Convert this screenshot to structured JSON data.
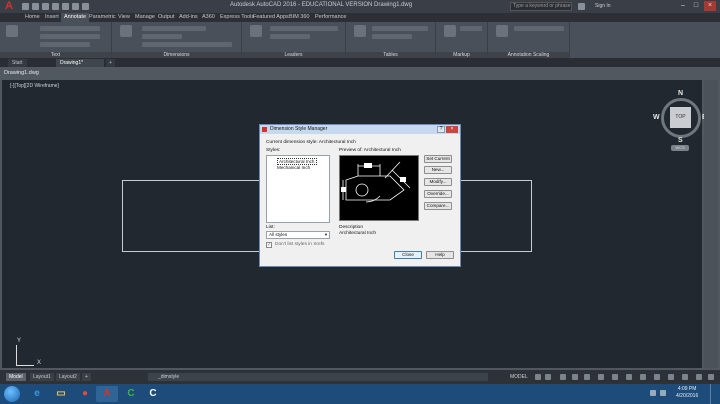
{
  "app": {
    "title": "Autodesk AutoCAD 2016 - EDUCATIONAL VERSION   Drawing1.dwg",
    "search_placeholder": "Type a keyword or phrase",
    "signin": "Sign In"
  },
  "ribbon_tabs": [
    "Home",
    "Insert",
    "Annotate",
    "Parametric",
    "View",
    "Manage",
    "Output",
    "Add-ins",
    "A360",
    "Express Tools",
    "Featured Apps",
    "BIM 360",
    "Performance"
  ],
  "ribbon_active_tab": "Annotate",
  "ribbon_panels": [
    "Text",
    "Dimensions",
    "Leaders",
    "Tables",
    "Markup",
    "Annotation Scaling"
  ],
  "doc_tabs": [
    "Start",
    "Drawing1*"
  ],
  "drawing": {
    "window_title": "Drawing1.dwg",
    "viewport_label": "[-][Top][2D Wireframe]",
    "viewcube": {
      "face": "TOP",
      "n": "N",
      "s": "S",
      "e": "E",
      "w": "W",
      "wcs": "WCS"
    },
    "ucs": {
      "x": "X",
      "y": "Y"
    }
  },
  "dialog": {
    "title": "Dimension Style Manager",
    "current_style": "Current dimension style: Architectural Inch",
    "styles_label": "Styles:",
    "styles": [
      "Architectural Inch",
      "Mechanical Inch"
    ],
    "preview_label": "Preview of: Architectural Inch",
    "buttons": [
      "Set Current",
      "New...",
      "Modify...",
      "Override...",
      "Compare..."
    ],
    "list_label": "List:",
    "list_value": "All styles",
    "xref_checkbox": "Don't list styles in Xrefs",
    "description_label": "Description",
    "description_value": "Architectural Inch",
    "close": "Close",
    "help": "Help"
  },
  "status": {
    "layout_tabs": [
      "Model",
      "Layout1",
      "Layout2"
    ],
    "command_prompt": "_dimstyle",
    "model_label": "MODEL"
  },
  "taskbar": {
    "time": "4:09 PM",
    "date": "4/20/2016"
  }
}
